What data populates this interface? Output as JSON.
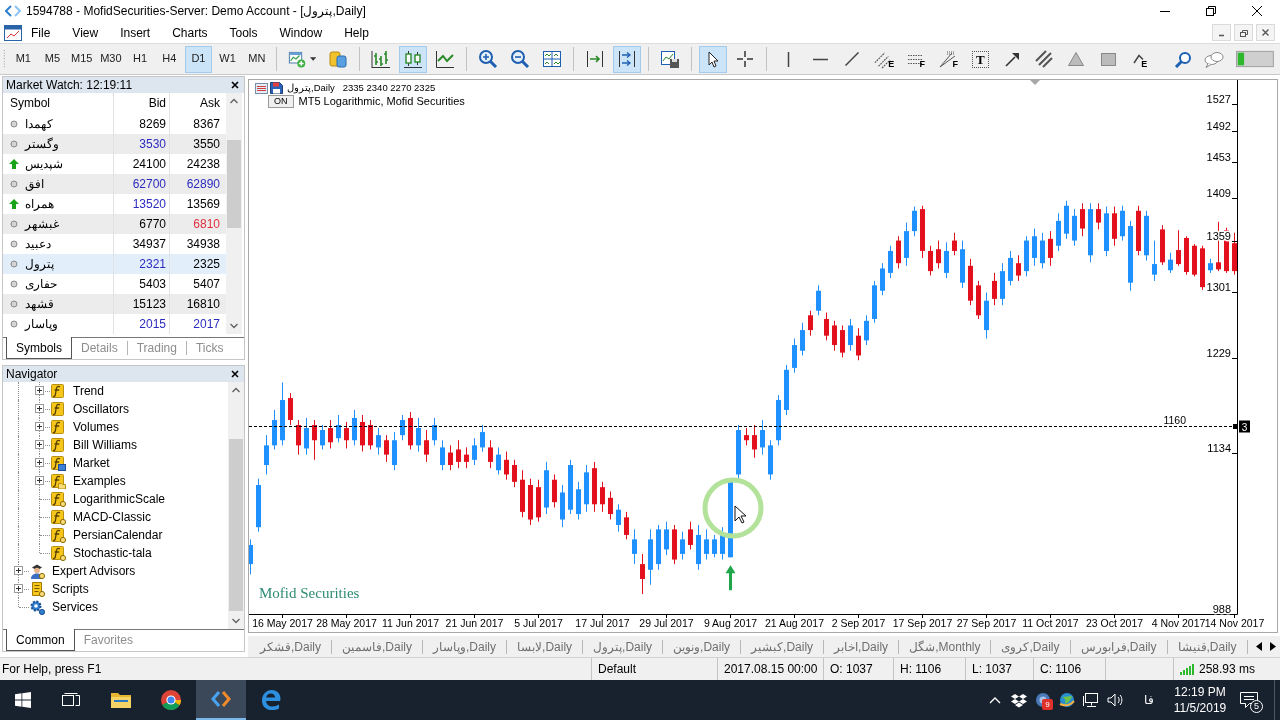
{
  "window": {
    "title": "1594788 - MofidSecurities-Server: Demo Account - [پترول,Daily]"
  },
  "menu": [
    "File",
    "View",
    "Insert",
    "Charts",
    "Tools",
    "Window",
    "Help"
  ],
  "toolbar": {
    "timeframes": [
      {
        "label": "M1",
        "selected": false
      },
      {
        "label": "M5",
        "selected": false
      },
      {
        "label": "M15",
        "selected": false
      },
      {
        "label": "M30",
        "selected": false
      },
      {
        "label": "H1",
        "selected": false
      },
      {
        "label": "H4",
        "selected": false
      },
      {
        "label": "D1",
        "selected": true
      },
      {
        "label": "W1",
        "selected": false
      },
      {
        "label": "MN",
        "selected": false
      }
    ],
    "tool_groups": [
      {
        "tools": [
          {
            "kind": "new-chart",
            "selected": false
          },
          {
            "kind": "coins",
            "selected": false
          }
        ]
      },
      {
        "tools": [
          {
            "kind": "bar-chart",
            "selected": false
          },
          {
            "kind": "candlesticks",
            "selected": true
          },
          {
            "kind": "line-chart",
            "selected": false
          }
        ]
      },
      {
        "tools": [
          {
            "kind": "zoom-in",
            "selected": false
          },
          {
            "kind": "zoom-out",
            "selected": false
          },
          {
            "kind": "tile",
            "selected": false
          }
        ]
      },
      {
        "tools": [
          {
            "kind": "chart-shift",
            "selected": false
          },
          {
            "kind": "auto-scroll",
            "selected": true
          }
        ]
      },
      {
        "tools": [
          {
            "kind": "templates",
            "selected": false
          }
        ]
      },
      {
        "tools": [
          {
            "kind": "cursor",
            "selected": true
          },
          {
            "kind": "crosshair",
            "selected": false
          }
        ]
      },
      {
        "tools": [
          {
            "kind": "vertical-line",
            "selected": false
          },
          {
            "kind": "horizontal-line",
            "selected": false
          },
          {
            "kind": "trend-line",
            "selected": false
          },
          {
            "kind": "channel",
            "letter": "E",
            "selected": false
          },
          {
            "kind": "fibo",
            "letter": "F",
            "selected": false
          },
          {
            "kind": "fibo-fan",
            "letter": "F",
            "selected": false
          },
          {
            "kind": "text",
            "letter": "T",
            "selected": false
          },
          {
            "kind": "arrow",
            "selected": false
          },
          {
            "kind": "parallel",
            "selected": false
          },
          {
            "kind": "triangle",
            "selected": false
          },
          {
            "kind": "rectangle",
            "selected": false
          },
          {
            "kind": "elliott",
            "letter": "E",
            "selected": false
          },
          {
            "kind": "search",
            "selected": false
          },
          {
            "kind": "chat",
            "selected": false
          },
          {
            "kind": "meter",
            "selected": false
          }
        ]
      }
    ]
  },
  "market_watch": {
    "title": "Market Watch: 12:19:11",
    "columns": [
      "Symbol",
      "Bid",
      "Ask"
    ],
    "rows": [
      {
        "rising": false,
        "symbol": "کهمدا",
        "bid": {
          "text": "8269",
          "color": "#000000"
        },
        "ask": {
          "text": "8367",
          "color": "#000000"
        },
        "selected": false
      },
      {
        "rising": false,
        "symbol": "وگستر",
        "bid": {
          "text": "3530",
          "color": "#2b2bbf"
        },
        "ask": {
          "text": "3550",
          "color": "#000000"
        },
        "selected": false
      },
      {
        "rising": true,
        "symbol": "شپدیس",
        "bid": {
          "text": "24100",
          "color": "#000000"
        },
        "ask": {
          "text": "24238",
          "color": "#000000"
        },
        "selected": false
      },
      {
        "rising": false,
        "symbol": "افق",
        "bid": {
          "text": "62700",
          "color": "#2b2bbf"
        },
        "ask": {
          "text": "62890",
          "color": "#2b2bbf"
        },
        "selected": false
      },
      {
        "rising": true,
        "symbol": "همراه",
        "bid": {
          "text": "13520",
          "color": "#2b2bbf"
        },
        "ask": {
          "text": "13569",
          "color": "#000000"
        },
        "selected": false
      },
      {
        "rising": false,
        "symbol": "غبشهر",
        "bid": {
          "text": "6770",
          "color": "#000000"
        },
        "ask": {
          "text": "6810",
          "color": "#e0303e"
        },
        "selected": false
      },
      {
        "rising": false,
        "symbol": "دعبید",
        "bid": {
          "text": "34937",
          "color": "#000000"
        },
        "ask": {
          "text": "34938",
          "color": "#000000"
        },
        "selected": false
      },
      {
        "rising": false,
        "symbol": "پترول",
        "bid": {
          "text": "2321",
          "color": "#2b2bbf"
        },
        "ask": {
          "text": "2325",
          "color": "#000000"
        },
        "selected": true
      },
      {
        "rising": false,
        "symbol": "حفاری",
        "bid": {
          "text": "5403",
          "color": "#000000"
        },
        "ask": {
          "text": "5407",
          "color": "#000000"
        },
        "selected": false
      },
      {
        "rising": false,
        "symbol": "قشهد",
        "bid": {
          "text": "15123",
          "color": "#000000"
        },
        "ask": {
          "text": "16810",
          "color": "#000000"
        },
        "selected": false
      },
      {
        "rising": false,
        "symbol": "وپاسار",
        "bid": {
          "text": "2015",
          "color": "#2b2bbf"
        },
        "ask": {
          "text": "2017",
          "color": "#2b2bbf"
        },
        "selected": false
      }
    ],
    "tabs": [
      {
        "label": "Symbols",
        "selected": true
      },
      {
        "label": "Details",
        "selected": false
      },
      {
        "label": "Trading",
        "selected": false
      },
      {
        "label": "Ticks",
        "selected": false
      }
    ]
  },
  "navigator": {
    "title": "Navigator",
    "tree": [
      {
        "children": [
          {
            "label": "Trend",
            "kind": "folder",
            "expanded": false
          },
          {
            "label": "Oscillators",
            "kind": "folder",
            "expanded": false
          },
          {
            "label": "Volumes",
            "kind": "folder",
            "expanded": false
          },
          {
            "label": "Bill Williams",
            "kind": "folder",
            "expanded": false
          },
          {
            "label": "Market",
            "kind": "market",
            "expanded": false
          },
          {
            "label": "Examples",
            "kind": "examples",
            "expanded": false
          },
          {
            "label": "LogarithmicScale",
            "kind": "indicator"
          },
          {
            "label": "MACD-Classic",
            "kind": "indicator"
          },
          {
            "label": "PersianCalendar",
            "kind": "indicator"
          },
          {
            "label": "Stochastic-tala",
            "kind": "indicator"
          }
        ]
      },
      {
        "label": "Expert Advisors",
        "kind": "experts",
        "expanded": false
      },
      {
        "label": "Scripts",
        "kind": "scripts",
        "expanded": false
      },
      {
        "label": "Services",
        "kind": "services"
      }
    ],
    "tabs": [
      {
        "label": "Common",
        "selected": true
      },
      {
        "label": "Favorites",
        "selected": false
      }
    ]
  },
  "chart": {
    "symbol_title": "پترول,Daily",
    "quote": "2335 2340 2270 2325",
    "indicator": {
      "button": "ON",
      "label": "MT5 Logarithmic, Mofid Securities"
    },
    "broker_label": "Mofid Securities",
    "chart_data": [
      {
        "type": "candlestick",
        "log": true,
        "ylim": [
          988,
          1556
        ],
        "yticks": [
          988,
          1134,
          1229,
          1301,
          1359,
          1409,
          1453,
          1492,
          1527
        ],
        "categories": [
          null,
          null,
          null,
          null,
          "16 May 2017",
          null,
          null,
          null,
          null,
          null,
          null,
          null,
          "28 May 2017",
          null,
          null,
          null,
          null,
          null,
          null,
          null,
          "11 Jun 2017",
          null,
          null,
          null,
          null,
          null,
          null,
          null,
          "21 Jun 2017",
          null,
          null,
          null,
          null,
          null,
          null,
          null,
          "5 Jul 2017",
          null,
          null,
          null,
          null,
          null,
          null,
          null,
          "17 Jul 2017",
          null,
          null,
          null,
          null,
          null,
          null,
          null,
          "29 Jul 2017",
          null,
          null,
          null,
          null,
          null,
          null,
          null,
          "9 Aug 2017",
          null,
          null,
          null,
          null,
          null,
          null,
          null,
          "21 Aug 2017",
          null,
          null,
          null,
          null,
          null,
          null,
          null,
          "2 Sep 2017",
          null,
          null,
          null,
          null,
          null,
          null,
          null,
          "17 Sep 2017",
          null,
          null,
          null,
          null,
          null,
          null,
          null,
          "27 Sep 2017",
          null,
          null,
          null,
          null,
          null,
          null,
          null,
          "11 Oct 2017",
          null,
          null,
          null,
          null,
          null,
          null,
          null,
          "23 Oct 2017",
          null,
          null,
          null,
          null,
          null,
          null,
          null,
          "4 Nov 2017",
          null,
          null,
          null,
          null,
          null,
          null,
          "14 Nov 2017"
        ],
        "ohlc": [
          [
            1031,
            1053,
            1022,
            1048
          ],
          [
            1064,
            1109,
            1060,
            1103
          ],
          [
            1122,
            1151,
            1113,
            1141
          ],
          [
            1141,
            1176,
            1137,
            1166
          ],
          [
            1146,
            1204,
            1141,
            1186
          ],
          [
            1188,
            1193,
            1161,
            1166
          ],
          [
            1161,
            1166,
            1132,
            1141
          ],
          [
            1138,
            1168,
            1132,
            1158
          ],
          [
            1161,
            1166,
            1127,
            1146
          ],
          [
            1141,
            1161,
            1137,
            1156
          ],
          [
            1158,
            1166,
            1138,
            1144
          ],
          [
            1148,
            1171,
            1144,
            1161
          ],
          [
            1158,
            1164,
            1138,
            1146
          ],
          [
            1146,
            1176,
            1141,
            1168
          ],
          [
            1164,
            1171,
            1135,
            1141
          ],
          [
            1161,
            1166,
            1137,
            1141
          ],
          [
            1139,
            1158,
            1132,
            1151
          ],
          [
            1146,
            1151,
            1125,
            1132
          ],
          [
            1122,
            1154,
            1117,
            1146
          ],
          [
            1151,
            1171,
            1146,
            1166
          ],
          [
            1168,
            1174,
            1137,
            1141
          ],
          [
            1141,
            1168,
            1135,
            1158
          ],
          [
            1146,
            1156,
            1125,
            1132
          ],
          [
            1146,
            1168,
            1141,
            1161
          ],
          [
            1122,
            1146,
            1117,
            1139
          ],
          [
            1134,
            1141,
            1117,
            1122
          ],
          [
            1137,
            1146,
            1119,
            1125
          ],
          [
            1132,
            1139,
            1119,
            1125
          ],
          [
            1127,
            1148,
            1122,
            1141
          ],
          [
            1139,
            1161,
            1135,
            1154
          ],
          [
            1139,
            1146,
            1119,
            1125
          ],
          [
            1117,
            1139,
            1113,
            1132
          ],
          [
            1127,
            1135,
            1108,
            1113
          ],
          [
            1122,
            1127,
            1101,
            1106
          ],
          [
            1108,
            1117,
            1073,
            1078
          ],
          [
            1103,
            1109,
            1066,
            1071
          ],
          [
            1101,
            1108,
            1069,
            1073
          ],
          [
            1082,
            1125,
            1076,
            1117
          ],
          [
            1108,
            1113,
            1082,
            1087
          ],
          [
            1071,
            1103,
            1064,
            1096
          ],
          [
            1080,
            1127,
            1076,
            1122
          ],
          [
            1076,
            1106,
            1071,
            1099
          ],
          [
            1085,
            1122,
            1078,
            1115
          ],
          [
            1119,
            1125,
            1078,
            1085
          ],
          [
            1101,
            1106,
            1078,
            1085
          ],
          [
            1091,
            1097,
            1071,
            1076
          ],
          [
            1066,
            1085,
            1060,
            1080
          ],
          [
            1073,
            1078,
            1053,
            1057
          ],
          [
            1040,
            1062,
            1031,
            1053
          ],
          [
            1031,
            1040,
            1005,
            1018
          ],
          [
            1026,
            1062,
            1013,
            1053
          ],
          [
            1031,
            1066,
            1026,
            1062
          ],
          [
            1044,
            1069,
            1039,
            1062
          ],
          [
            1062,
            1066,
            1031,
            1035
          ],
          [
            1040,
            1060,
            1035,
            1053
          ],
          [
            1062,
            1069,
            1044,
            1048
          ],
          [
            1031,
            1066,
            1026,
            1057
          ],
          [
            1040,
            1062,
            1035,
            1053
          ],
          [
            1040,
            1057,
            1037,
            1053
          ],
          [
            1040,
            1064,
            1035,
            1057
          ],
          [
            1037,
            1106,
            1037,
            1106
          ],
          [
            1113,
            1161,
            1108,
            1156
          ],
          [
            1151,
            1158,
            1141,
            1146
          ],
          [
            1151,
            1161,
            1129,
            1137
          ],
          [
            1139,
            1166,
            1132,
            1156
          ],
          [
            1113,
            1146,
            1108,
            1141
          ],
          [
            1146,
            1191,
            1141,
            1186
          ],
          [
            1176,
            1222,
            1171,
            1217
          ],
          [
            1219,
            1250,
            1214,
            1243
          ],
          [
            1237,
            1267,
            1232,
            1259
          ],
          [
            1275,
            1280,
            1253,
            1259
          ],
          [
            1280,
            1308,
            1275,
            1302
          ],
          [
            1271,
            1278,
            1248,
            1253
          ],
          [
            1264,
            1269,
            1237,
            1243
          ],
          [
            1259,
            1264,
            1230,
            1235
          ],
          [
            1243,
            1271,
            1237,
            1264
          ],
          [
            1253,
            1261,
            1227,
            1232
          ],
          [
            1248,
            1275,
            1243,
            1269
          ],
          [
            1271,
            1313,
            1267,
            1308
          ],
          [
            1302,
            1333,
            1297,
            1327
          ],
          [
            1322,
            1353,
            1316,
            1347
          ],
          [
            1359,
            1364,
            1327,
            1333
          ],
          [
            1339,
            1380,
            1330,
            1370
          ],
          [
            1370,
            1399,
            1364,
            1394
          ],
          [
            1396,
            1400,
            1339,
            1347
          ],
          [
            1347,
            1353,
            1319,
            1324
          ],
          [
            1349,
            1359,
            1327,
            1333
          ],
          [
            1322,
            1357,
            1316,
            1347
          ],
          [
            1359,
            1368,
            1342,
            1347
          ],
          [
            1311,
            1359,
            1305,
            1349
          ],
          [
            1330,
            1338,
            1286,
            1291
          ],
          [
            1308,
            1313,
            1271,
            1275
          ],
          [
            1259,
            1300,
            1250,
            1291
          ],
          [
            1313,
            1322,
            1286,
            1293
          ],
          [
            1293,
            1333,
            1286,
            1324
          ],
          [
            1313,
            1347,
            1308,
            1339
          ],
          [
            1333,
            1342,
            1313,
            1319
          ],
          [
            1324,
            1364,
            1318,
            1359
          ],
          [
            1339,
            1373,
            1330,
            1364
          ],
          [
            1333,
            1368,
            1327,
            1359
          ],
          [
            1361,
            1370,
            1330,
            1339
          ],
          [
            1353,
            1391,
            1347,
            1382
          ],
          [
            1367,
            1406,
            1361,
            1400
          ],
          [
            1359,
            1396,
            1353,
            1388
          ],
          [
            1396,
            1403,
            1364,
            1373
          ],
          [
            1342,
            1403,
            1334,
            1396
          ],
          [
            1396,
            1403,
            1372,
            1380
          ],
          [
            1347,
            1399,
            1341,
            1391
          ],
          [
            1391,
            1399,
            1353,
            1361
          ],
          [
            1364,
            1400,
            1359,
            1394
          ],
          [
            1311,
            1382,
            1302,
            1376
          ],
          [
            1394,
            1400,
            1342,
            1347
          ],
          [
            1342,
            1394,
            1336,
            1388
          ],
          [
            1320,
            1359,
            1313,
            1332
          ],
          [
            1372,
            1377,
            1331,
            1334
          ],
          [
            1325,
            1345,
            1322,
            1337
          ],
          [
            1348,
            1371,
            1330,
            1332
          ],
          [
            1362,
            1364,
            1320,
            1323
          ],
          [
            1353,
            1355,
            1318,
            1320
          ],
          [
            1350,
            1353,
            1303,
            1306
          ],
          [
            1325,
            1338,
            1322,
            1333
          ],
          [
            1334,
            1381,
            1324,
            1326
          ],
          [
            1371,
            1374,
            1322,
            1324
          ],
          [
            1356,
            1368,
            1320,
            1324
          ]
        ],
        "ref_lines": [
          {
            "axis": "y",
            "value": 1160,
            "label": "1160",
            "color": "#000000",
            "line_style": "dashed"
          }
        ],
        "annotations": [
          "3"
        ]
      }
    ]
  },
  "chart_tabs": [
    "قشکر,Daily",
    "فاسمین,Daily",
    "وپاسار,Daily",
    "لابسا,Daily",
    "پترول,Daily",
    "ونوین,Daily",
    "کبشیر,Daily",
    "اخابر,Daily",
    "شگل,Monthly",
    "کروی,Daily",
    "فرابورس,Daily",
    "قنیشا,Daily"
  ],
  "status_bar": {
    "help": "For Help, press F1",
    "profile": "Default",
    "time": "2017.08.15 00:00",
    "open": "O: 1037",
    "high": "H: 1106",
    "low": "L: 1037",
    "close": "C: 1106",
    "ping": "258.93 ms"
  },
  "taskbar": {
    "apps": [
      {
        "kind": "files",
        "selected": false
      },
      {
        "kind": "browser",
        "selected": false
      },
      {
        "kind": "terminal",
        "selected": true
      },
      {
        "kind": "edge",
        "selected": false
      }
    ],
    "tray_badge": "9",
    "language": "فا",
    "time": "12:19 PM",
    "date": "11/5/2019",
    "notifications": "5"
  }
}
